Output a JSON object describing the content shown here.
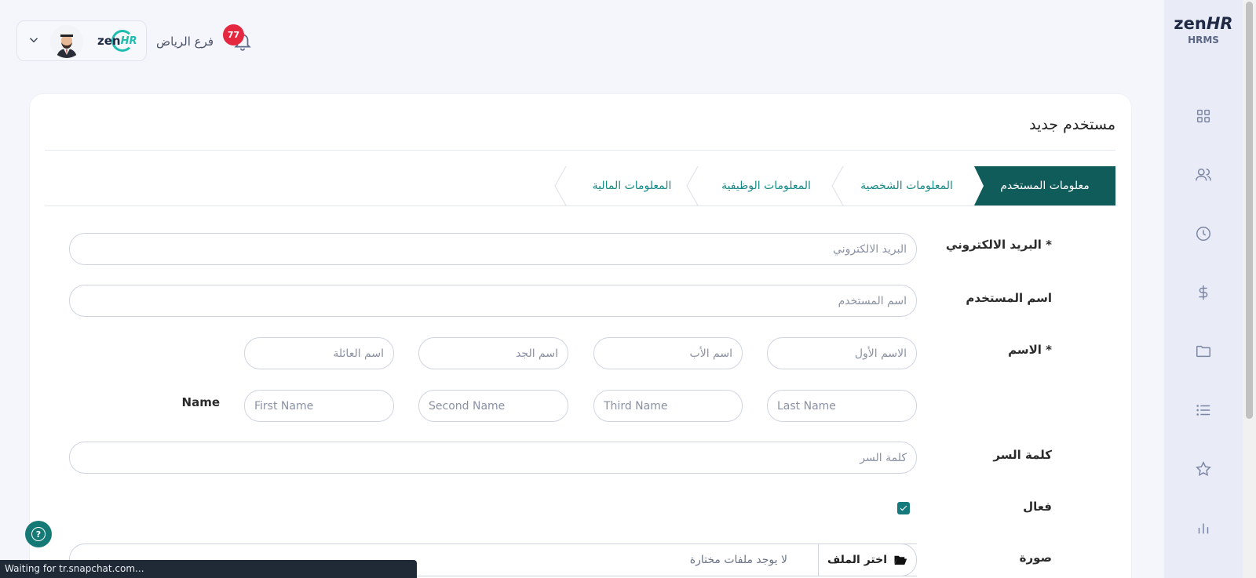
{
  "brand": {
    "logo": "zenHR",
    "logo_main": "zen",
    "logo_accent": "HR",
    "sub": "HRMS"
  },
  "header": {
    "branch": "فرع الرياض",
    "notifications_count": "77",
    "mini_logo_main": "zen",
    "mini_logo_accent": "HR"
  },
  "sidebar": {
    "icons": [
      "grid-icon",
      "users-icon",
      "clock-icon",
      "dollar-icon",
      "folder-icon",
      "list-icon",
      "star-icon",
      "bar-chart-icon"
    ]
  },
  "page": {
    "title": "مستخدم جديد",
    "tabs": [
      {
        "label": "معلومات المستخدم",
        "active": true
      },
      {
        "label": "المعلومات الشخصية",
        "active": false
      },
      {
        "label": "المعلومات الوظيفية",
        "active": false
      },
      {
        "label": "المعلومات المالية",
        "active": false
      }
    ]
  },
  "form": {
    "email": {
      "label": "البريد الالكتروني",
      "required": "*",
      "placeholder": "البريد الالكتروني"
    },
    "username": {
      "label": "اسم المستخدم",
      "placeholder": "اسم المستخدم"
    },
    "name_ar": {
      "label": "الاسم",
      "required": "*",
      "first": "الاسم الأول",
      "father": "اسم الأب",
      "grandfather": "اسم الجد",
      "family": "اسم العائلة"
    },
    "name_en": {
      "label": "Name",
      "last": "Last Name",
      "third": "Third Name",
      "second": "Second Name",
      "first": "First Name"
    },
    "password": {
      "label": "كلمة السر",
      "placeholder": "كلمة السر"
    },
    "active": {
      "label": "فعال",
      "checked": true
    },
    "photo": {
      "label": "صورة",
      "button": "اختر الملف",
      "status": "لا يوجد ملفات مختارة"
    }
  },
  "status_bar": "Waiting for tr.snapchat.com...",
  "colors": {
    "primary": "#0f5c5a",
    "accent": "#178a86",
    "badge": "#e4283f"
  }
}
